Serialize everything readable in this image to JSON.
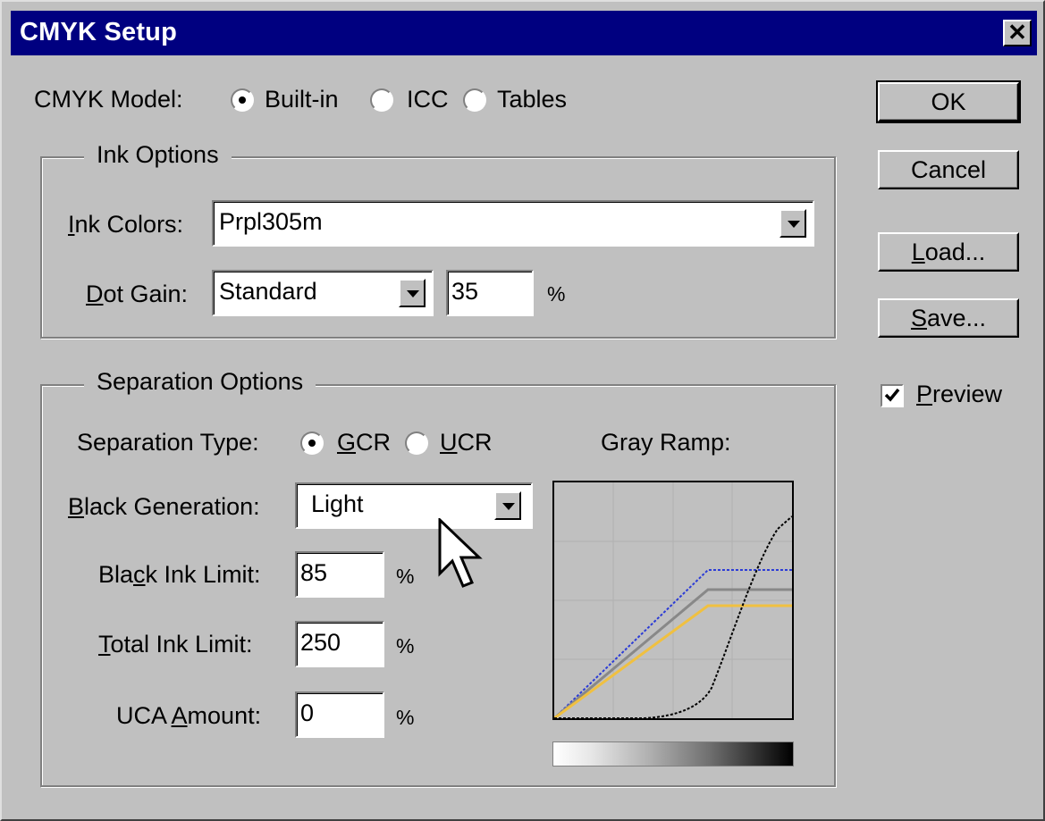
{
  "window": {
    "title": "CMYK Setup",
    "close": "✕"
  },
  "cmyk_model": {
    "label": "CMYK Model:",
    "options": [
      "Built-in",
      "ICC",
      "Tables"
    ],
    "selected": "Built-in"
  },
  "ink_options": {
    "legend": "Ink Options",
    "ink_colors_label_u": "I",
    "ink_colors_label_rest": "nk Colors:",
    "ink_colors_value": "Prpl305m",
    "dot_gain_label_u": "D",
    "dot_gain_label_rest": "ot Gain:",
    "dot_gain_value": "Standard",
    "dot_gain_percent": "35",
    "percent": "%"
  },
  "separation_options": {
    "legend": "Separation Options",
    "type_label": "Separation Type:",
    "gcr_u": "G",
    "gcr_rest": "CR",
    "ucr_u": "U",
    "ucr_rest": "CR",
    "selected_type": "GCR",
    "black_gen_label_u": "B",
    "black_gen_label_rest": "lack Generation:",
    "black_gen_value": "Light",
    "black_limit_label_pre": "Bla",
    "black_limit_label_u": "c",
    "black_limit_label_rest": "k Ink Limit:",
    "black_limit_value": "85",
    "total_limit_label_u": "T",
    "total_limit_label_rest": "otal Ink Limit:",
    "total_limit_value": "250",
    "uca_label_pre": "UCA ",
    "uca_label_u": "A",
    "uca_label_rest": "mount:",
    "uca_value": "0",
    "percent": "%",
    "gray_ramp_label": "Gray Ramp:"
  },
  "buttons": {
    "ok": "OK",
    "cancel": "Cancel",
    "load_u": "L",
    "load_rest": "oad...",
    "save_u": "S",
    "save_rest": "ave..."
  },
  "preview": {
    "label_u": "P",
    "label_rest": "review",
    "checked": true
  },
  "gray_ramp_colors": {
    "cyan": "#2b3bd6",
    "magenta": "#888888",
    "yellow": "#f0c040",
    "black": "#000000"
  }
}
